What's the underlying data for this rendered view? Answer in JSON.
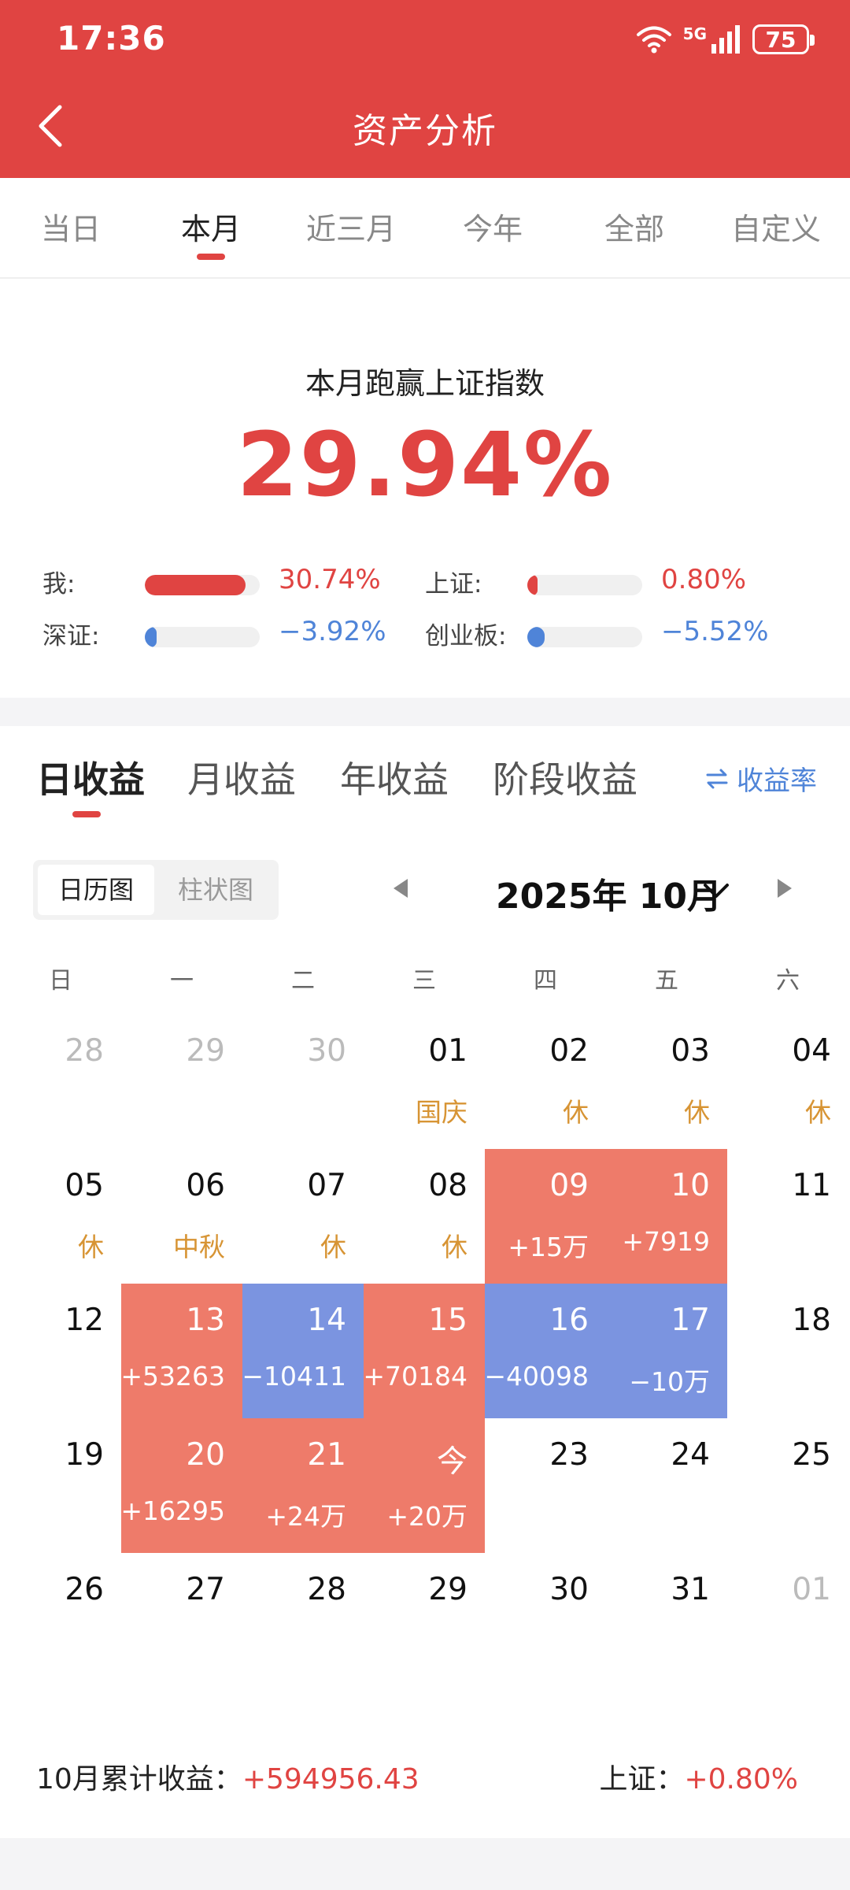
{
  "status": {
    "time": "17:36",
    "network": "5G",
    "battery": "75"
  },
  "nav": {
    "title": "资产分析"
  },
  "period_tabs": [
    {
      "label": "当日",
      "active": false
    },
    {
      "label": "本月",
      "active": true
    },
    {
      "label": "近三月",
      "active": false
    },
    {
      "label": "今年",
      "active": false
    },
    {
      "label": "全部",
      "active": false
    },
    {
      "label": "自定义",
      "active": false
    }
  ],
  "summary": {
    "label": "本月跑赢上证指数",
    "value": "29.94%",
    "comparisons": [
      {
        "label": "我:",
        "pct": "30.74%",
        "level": 0.88,
        "trend": "up"
      },
      {
        "label": "上证:",
        "pct": "0.80%",
        "level": 0.03,
        "trend": "up"
      },
      {
        "label": "深证:",
        "pct": "−3.92%",
        "level": 0.1,
        "trend": "down"
      },
      {
        "label": "创业板:",
        "pct": "−5.52%",
        "level": 0.15,
        "trend": "down"
      }
    ]
  },
  "income_tabs": [
    {
      "label": "日收益",
      "active": true
    },
    {
      "label": "月收益",
      "active": false
    },
    {
      "label": "年收益",
      "active": false
    },
    {
      "label": "阶段收益",
      "active": false
    }
  ],
  "rate_toggle": "收益率",
  "view_switch": {
    "calendar": "日历图",
    "bar": "柱状图"
  },
  "month": "2025年 10月",
  "weekdays": [
    "日",
    "一",
    "二",
    "三",
    "四",
    "五",
    "六"
  ],
  "calendar": [
    [
      {
        "day": "28",
        "other": true
      },
      {
        "day": "29",
        "other": true
      },
      {
        "day": "30",
        "other": true
      },
      {
        "day": "01",
        "sub": "国庆",
        "kind": "holiday"
      },
      {
        "day": "02",
        "sub": "休",
        "kind": "holiday"
      },
      {
        "day": "03",
        "sub": "休",
        "kind": "holiday"
      },
      {
        "day": "04",
        "sub": "休",
        "kind": "holiday"
      }
    ],
    [
      {
        "day": "05",
        "sub": "休",
        "kind": "holiday"
      },
      {
        "day": "06",
        "sub": "中秋",
        "kind": "holiday"
      },
      {
        "day": "07",
        "sub": "休",
        "kind": "holiday"
      },
      {
        "day": "08",
        "sub": "休",
        "kind": "holiday"
      },
      {
        "day": "09",
        "sub": "+15万",
        "kind": "gain"
      },
      {
        "day": "10",
        "sub": "+7919",
        "kind": "gain"
      },
      {
        "day": "11"
      }
    ],
    [
      {
        "day": "12"
      },
      {
        "day": "13",
        "sub": "+53263",
        "kind": "gain"
      },
      {
        "day": "14",
        "sub": "−10411",
        "kind": "loss"
      },
      {
        "day": "15",
        "sub": "+70184",
        "kind": "gain"
      },
      {
        "day": "16",
        "sub": "−40098",
        "kind": "loss"
      },
      {
        "day": "17",
        "sub": "−10万",
        "kind": "loss"
      },
      {
        "day": "18"
      }
    ],
    [
      {
        "day": "19"
      },
      {
        "day": "20",
        "sub": "+16295",
        "kind": "gain"
      },
      {
        "day": "21",
        "sub": "+24万",
        "kind": "gain"
      },
      {
        "day": "今",
        "sub": "+20万",
        "kind": "gain"
      },
      {
        "day": "23"
      },
      {
        "day": "24"
      },
      {
        "day": "25"
      }
    ],
    [
      {
        "day": "26"
      },
      {
        "day": "27"
      },
      {
        "day": "28"
      },
      {
        "day": "29"
      },
      {
        "day": "30"
      },
      {
        "day": "31"
      },
      {
        "day": "01",
        "other": true
      }
    ]
  ],
  "footer": {
    "cum_label": "10月累计收益：",
    "cum_value": "+594956.43",
    "index_label": "上证：",
    "index_value": "+0.80%"
  },
  "colors": {
    "brand": "#e04442",
    "down": "#4f84d8",
    "gain_cell": "#ee7b6a",
    "loss_cell": "#7b94e0",
    "holiday": "#d79434"
  }
}
